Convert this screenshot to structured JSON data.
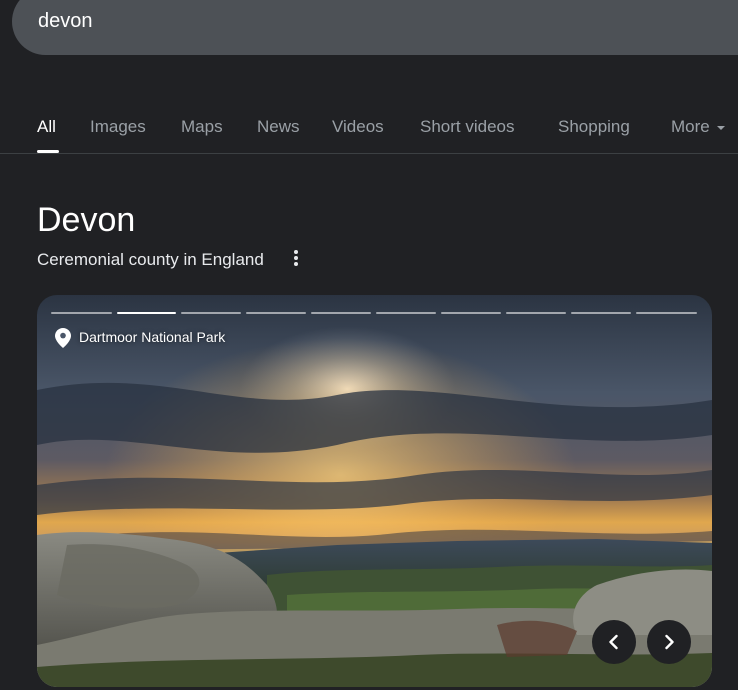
{
  "search": {
    "query": "devon"
  },
  "tabs": [
    {
      "label": "All",
      "active": true
    },
    {
      "label": "Images"
    },
    {
      "label": "Maps"
    },
    {
      "label": "News"
    },
    {
      "label": "Videos"
    },
    {
      "label": "Short videos"
    },
    {
      "label": "Shopping"
    },
    {
      "label": "More",
      "icon": "caret-down-icon"
    }
  ],
  "knowledge_panel": {
    "title": "Devon",
    "subtitle": "Ceremonial county in England",
    "menu_icon": "more-vert-icon",
    "photo": {
      "location_icon": "location-pin-icon",
      "location": "Dartmoor National Park",
      "slide_count": 10,
      "active_slide": 2,
      "prev_icon": "chevron-left-icon",
      "next_icon": "chevron-right-icon"
    }
  },
  "colors": {
    "background": "#202124",
    "search_bar": "#4d5156",
    "tab_inactive": "#9aa0a6",
    "text_primary": "#ffffff"
  }
}
